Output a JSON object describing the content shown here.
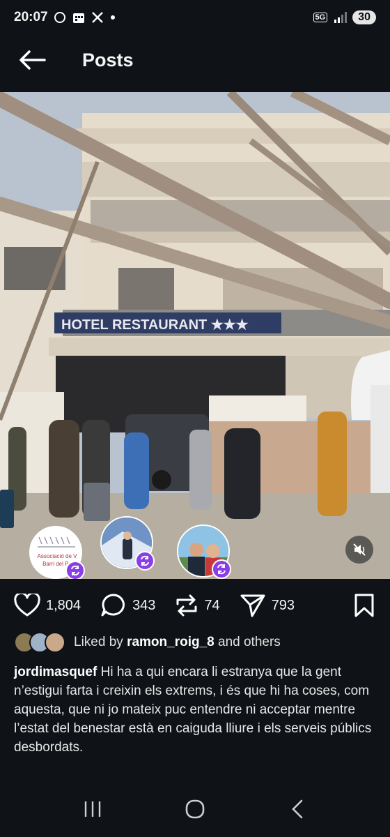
{
  "status_bar": {
    "time": "20:07",
    "network": "5G",
    "battery": "30"
  },
  "header": {
    "title": "Posts"
  },
  "media": {
    "sign_text": "HOTEL RESTAURANT ★★★",
    "tagged_accounts": [
      {
        "label_line1": "Associació de V",
        "label_line2": "Barri del Po"
      },
      {
        "label_line1": "",
        "label_line2": ""
      },
      {
        "label_line1": "",
        "label_line2": ""
      }
    ]
  },
  "actions": {
    "likes": "1,804",
    "comments": "343",
    "reposts": "74",
    "shares": "793"
  },
  "liked_by": {
    "prefix": "Liked by",
    "user": "ramon_roig_8",
    "suffix": "and others"
  },
  "caption": {
    "username": "jordimasquef",
    "text": "Hi ha a qui encara li estranya que la gent n’estigui farta i creixin els extrems, i és que hi ha coses, com aquesta, que ni jo mateix puc entendre ni acceptar mentre l’estat del benestar està en caiguda lliure i els serveis públics desbordats."
  },
  "colors": {
    "background": "#0f1217",
    "accent_purple": "#8a3ee6"
  }
}
